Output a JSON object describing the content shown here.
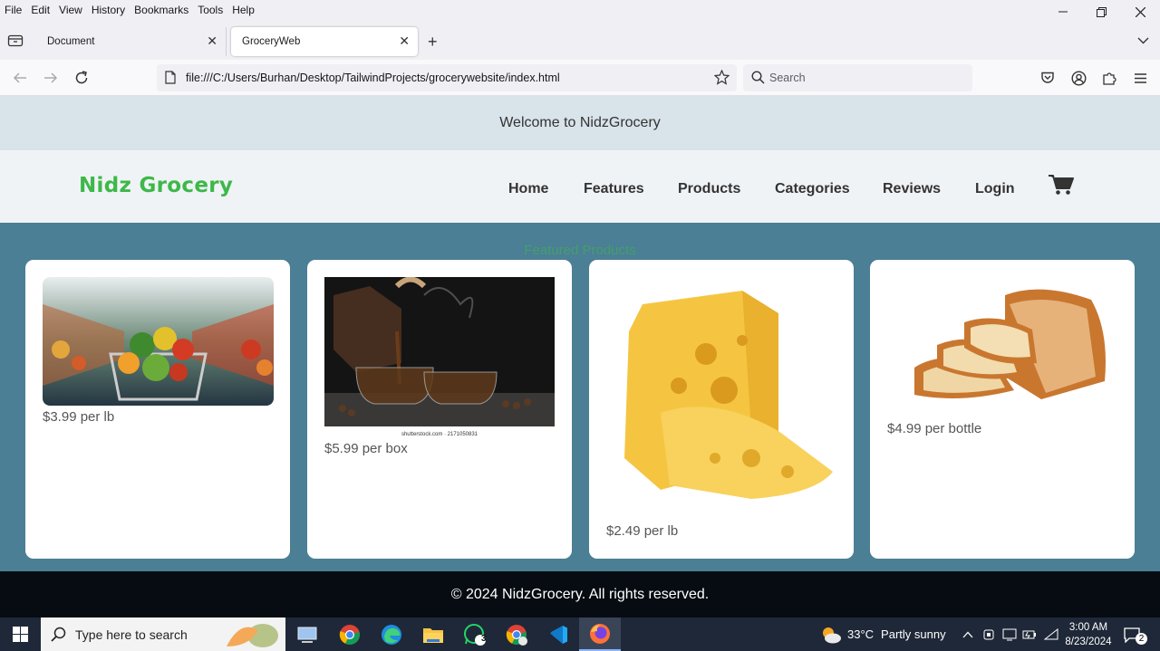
{
  "menubar": [
    "File",
    "Edit",
    "View",
    "History",
    "Bookmarks",
    "Tools",
    "Help"
  ],
  "tabs": [
    {
      "title": "Document"
    },
    {
      "title": "GroceryWeb"
    }
  ],
  "address_bar": {
    "url": "file:///C:/Users/Burhan/Desktop/TailwindProjects/grocerywebsite/index.html"
  },
  "search_bar": {
    "placeholder": "Search"
  },
  "site": {
    "welcome": "Welcome to NidzGrocery",
    "logo": "Nidz Grocery",
    "nav": [
      "Home",
      "Features",
      "Products",
      "Categories",
      "Reviews",
      "Login"
    ],
    "featured_title": "Featured Products",
    "products": [
      {
        "price": "$3.99 per lb"
      },
      {
        "price": "$5.99 per box",
        "watermark": "shutterstock.com · 2171050831"
      },
      {
        "price": "$2.49 per lb"
      },
      {
        "price": "$4.99 per bottle"
      }
    ],
    "footer": "© 2024 NidzGrocery. All rights reserved."
  },
  "taskbar": {
    "search_placeholder": "Type here to search",
    "whatsapp_badge": "3",
    "weather_temp": "33°C",
    "weather_desc": "Partly sunny",
    "time": "3:00 AM",
    "date": "8/23/2024",
    "notifications": "2"
  },
  "colors": {
    "accent_green": "#3db849",
    "page_bg": "#4b7f95",
    "footer_bg": "#070c12"
  }
}
